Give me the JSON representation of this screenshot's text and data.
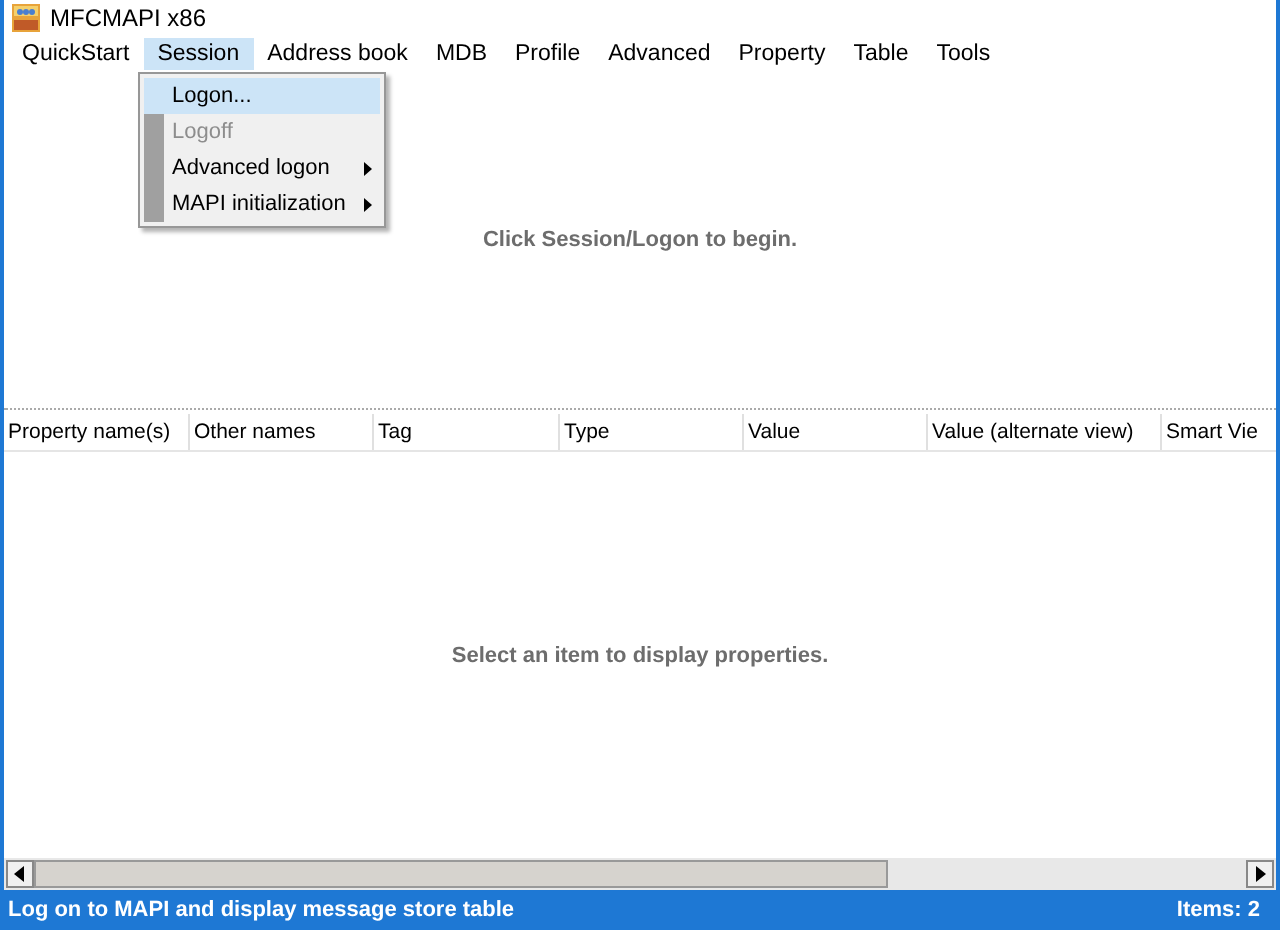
{
  "window": {
    "title": "MFCMAPI x86"
  },
  "menu": [
    {
      "label": "QuickStart",
      "selected": false
    },
    {
      "label": "Session",
      "selected": true
    },
    {
      "label": "Address book",
      "selected": false
    },
    {
      "label": "MDB",
      "selected": false
    },
    {
      "label": "Profile",
      "selected": false
    },
    {
      "label": "Advanced",
      "selected": false
    },
    {
      "label": "Property",
      "selected": false
    },
    {
      "label": "Table",
      "selected": false
    },
    {
      "label": "Tools",
      "selected": false
    }
  ],
  "dropdown": [
    {
      "label": "Logon...",
      "selected": true,
      "disabled": false,
      "submenu": false
    },
    {
      "label": "Logoff",
      "selected": false,
      "disabled": true,
      "submenu": false
    },
    {
      "label": "Advanced logon",
      "selected": false,
      "disabled": false,
      "submenu": true
    },
    {
      "label": "MAPI initialization",
      "selected": false,
      "disabled": false,
      "submenu": true
    }
  ],
  "top_pane": {
    "message": "Click Session/Logon to begin."
  },
  "table": {
    "columns": [
      "Property name(s)",
      "Other names",
      "Tag",
      "Type",
      "Value",
      "Value (alternate view)",
      "Smart Vie"
    ],
    "empty_message": "Select an item to display properties."
  },
  "status_bar": {
    "text": "Log on to MAPI and display message store table",
    "items": "Items: 2"
  }
}
